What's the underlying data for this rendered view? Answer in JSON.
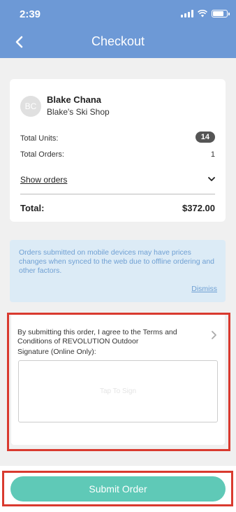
{
  "status_bar": {
    "time": "2:39"
  },
  "header": {
    "title": "Checkout"
  },
  "customer": {
    "initials": "BC",
    "name": "Blake Chana",
    "shop": "Blake's Ski Shop"
  },
  "summary": {
    "total_units_label": "Total Units:",
    "total_units_value": "14",
    "total_orders_label": "Total Orders:",
    "total_orders_value": "1",
    "show_orders_label": "Show orders",
    "total_label": "Total:",
    "total_value": "$372.00"
  },
  "notice": {
    "text": "Orders submitted on mobile devices may have prices changes when synced to the web due to offline ordering and other factors.",
    "dismiss_label": "Dismiss"
  },
  "terms": {
    "text": "By submitting this order, I agree to the Terms and Conditions of REVOLUTION Outdoor",
    "signature_label": "Signature (Online Only):",
    "signature_placeholder": "Tap To Sign"
  },
  "submit": {
    "label": "Submit Order"
  },
  "colors": {
    "header": "#6d99d6",
    "accent": "#5fc9b7",
    "notice_text": "#6e9fd3",
    "highlight": "#d93a2f"
  }
}
